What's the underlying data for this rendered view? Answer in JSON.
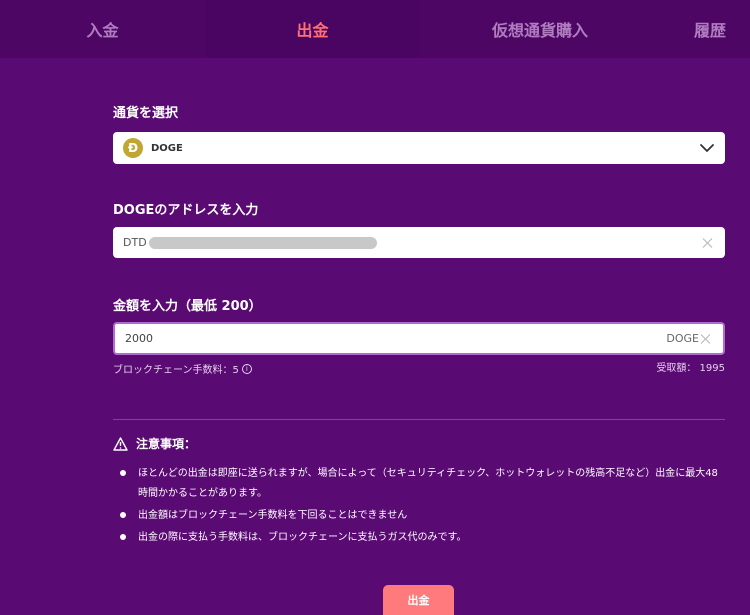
{
  "tabs": [
    {
      "label": "入金"
    },
    {
      "label": "出金"
    },
    {
      "label": "仮想通貨購入"
    },
    {
      "label": "履歴"
    }
  ],
  "currency": {
    "label": "通貨を選択",
    "selected": "DOGE",
    "icon_letter": "Ð",
    "icon_color": "#c2a633"
  },
  "address": {
    "label": "DOGEのアドレスを入力",
    "value_prefix": "DTD"
  },
  "amount": {
    "label": "金額を入力（最低 200）",
    "value": "2000",
    "unit": "DOGE",
    "fee": "ブロックチェーン手数料：5",
    "received": "受取額： 1995"
  },
  "notice": {
    "title": "注意事項：",
    "items": [
      "ほとんどの出金は即座に送られますが、場合によって（セキュリティチェック、ホットウォレットの残高不足など）出金に最大48時間かかることがあります。",
      "出金額はブロックチェーン手数料を下回ることはできません",
      "出金の際に支払う手数料は、ブロックチェーンに支払うガス代のみです。"
    ]
  },
  "submit_label": "出金",
  "colors": {
    "background": "#5a0a73",
    "active_tab": "#ff6f73",
    "button": "#ff7a7c"
  }
}
